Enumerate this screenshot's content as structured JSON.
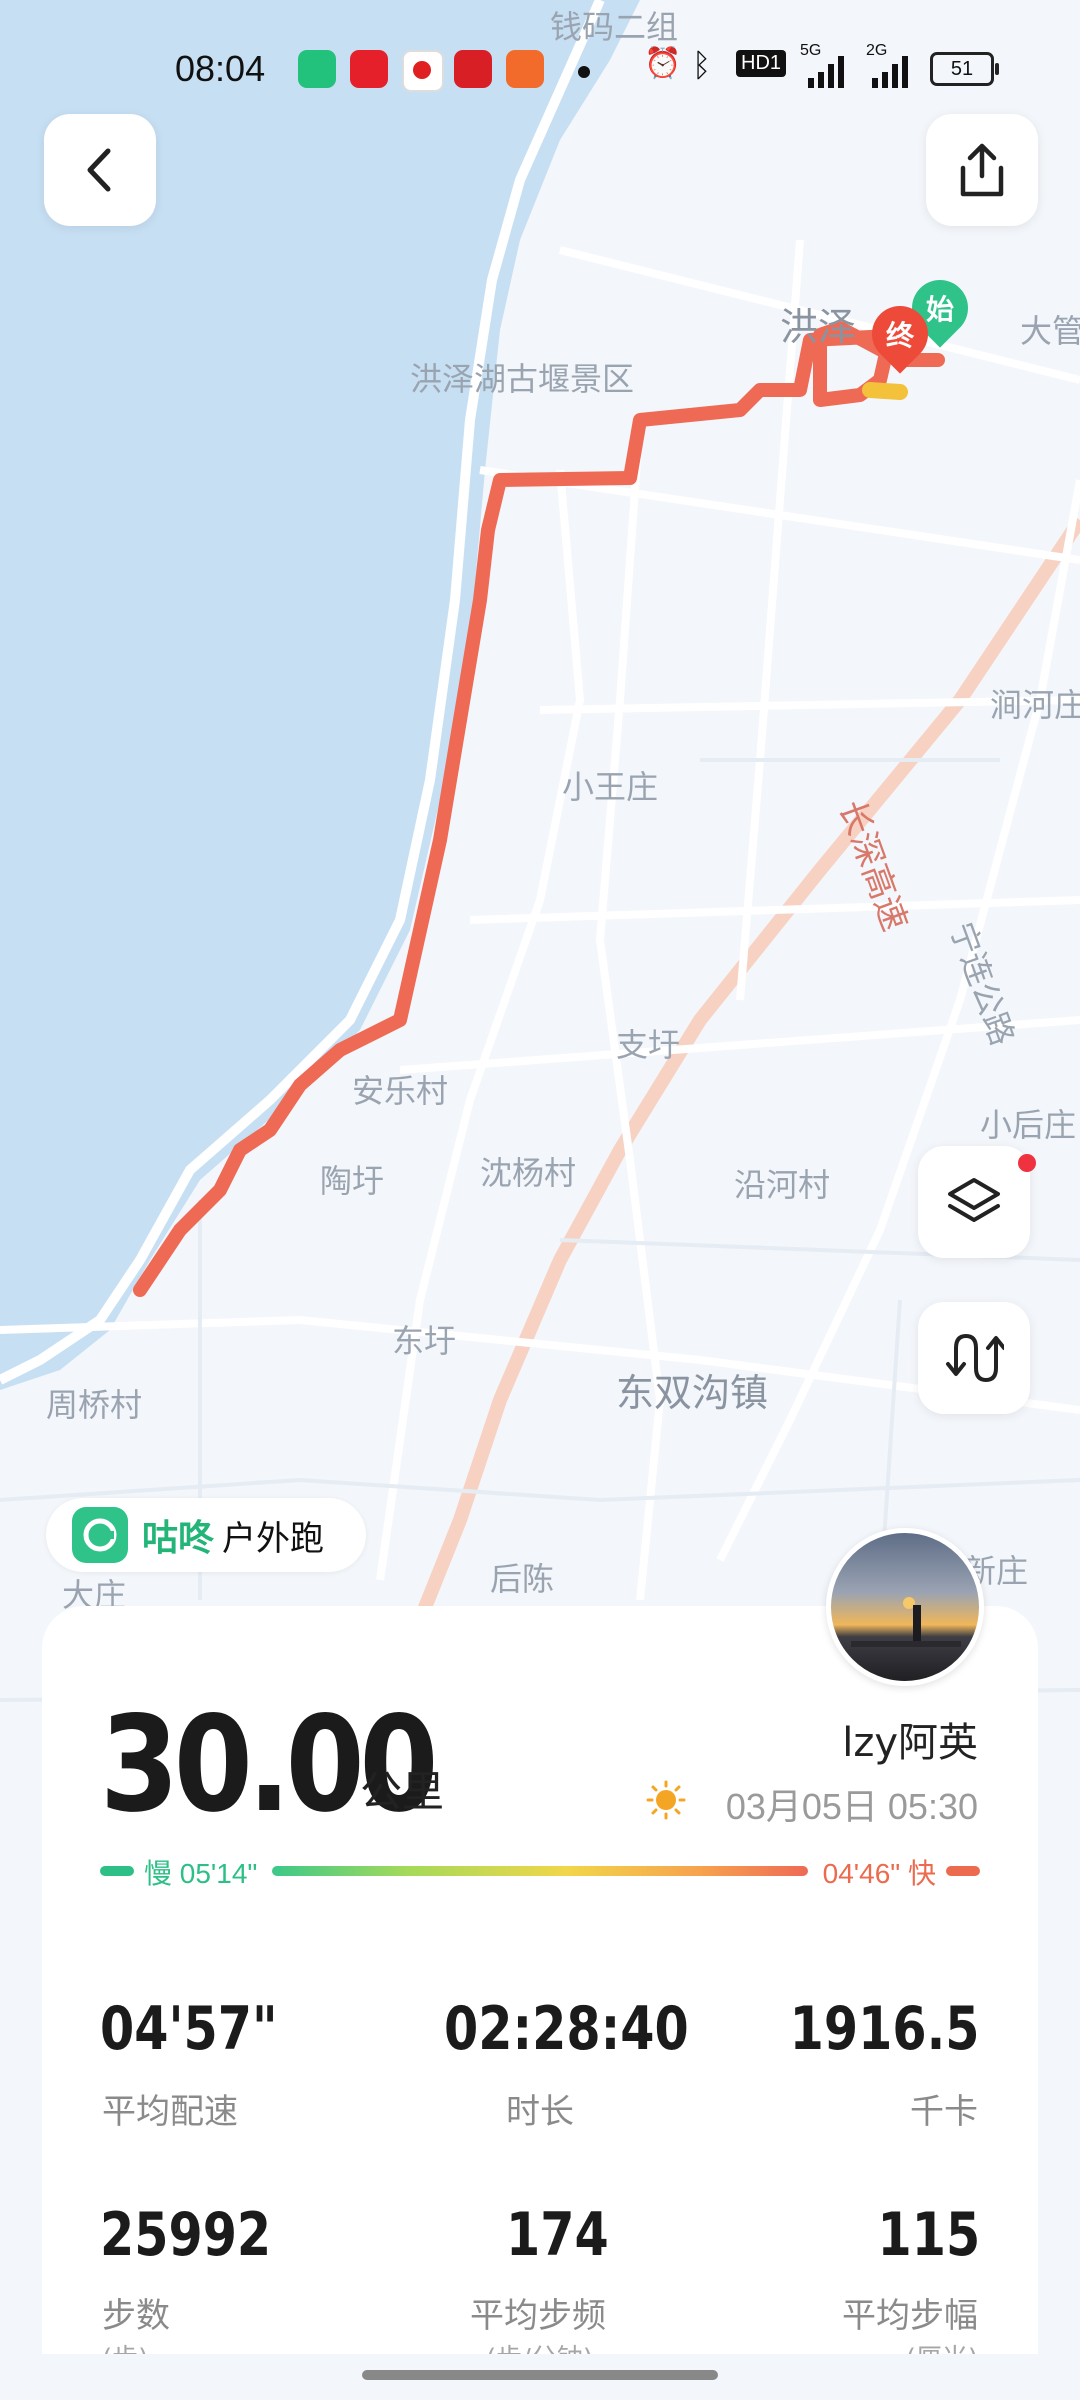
{
  "status_bar": {
    "time": "08:04",
    "notification_icons": [
      "app-green-icon",
      "app-red-icon",
      "app-youtube-icon",
      "app-study-icon",
      "app-orange-icon"
    ],
    "signal_5g": "5G",
    "signal_2g": "2G",
    "hd_label": "HD1",
    "battery": "51"
  },
  "map": {
    "labels": {
      "top": "钱码二组",
      "hongze": "洪泽",
      "dagan": "大管",
      "scenic": "洪泽湖古堰景区",
      "jianhe": "涧河庄",
      "xiaowang": "小王庄",
      "highway_cs": "长深高速",
      "ninglian": "宁连公路",
      "zhiyu": "支圩",
      "anle": "安乐村",
      "xiaohou": "小后庄",
      "taoyu": "陶圩",
      "shenyang": "沈杨村",
      "yanhe": "沿河村",
      "dongyu": "东圩",
      "dongshuang": "东双沟镇",
      "zhouqiao": "周桥村",
      "dazhuang": "大庄",
      "houchen": "后陈",
      "xin": "新庄"
    },
    "start_marker": "始",
    "end_marker": "终"
  },
  "brand": {
    "name": "咕咚",
    "sport": "户外跑"
  },
  "summary": {
    "distance": "30.00",
    "distance_unit": "公里",
    "username": "lzy阿英",
    "date": "03月05日 05:30",
    "pace_slow": "慢 05'14\"",
    "pace_fast": "04'46\" 快"
  },
  "stats": [
    {
      "value": "04'57\"",
      "label": "平均配速"
    },
    {
      "value": "02:28:40",
      "label": "时长"
    },
    {
      "value": "1916.5",
      "label": "千卡"
    },
    {
      "value": "25992",
      "label": "步数",
      "sub": "(步)"
    },
    {
      "value": "174",
      "label": "平均步频",
      "sub": "(步/分钟)"
    },
    {
      "value": "115",
      "label": "平均步幅",
      "sub": "(厘米)"
    }
  ],
  "colors": {
    "route": "#ee6a55",
    "water": "#c7dff3",
    "accent_green": "#2fc38a",
    "fast_red": "#ec6a4e"
  }
}
